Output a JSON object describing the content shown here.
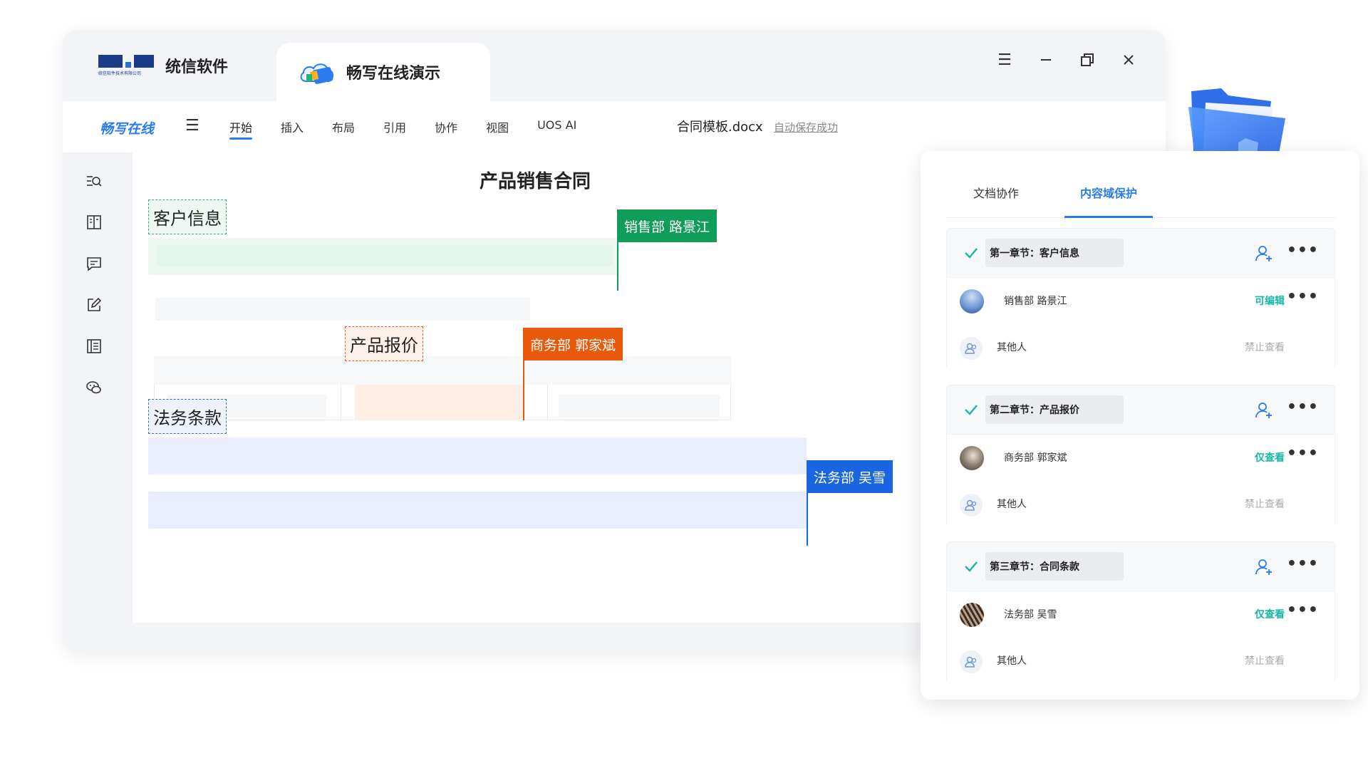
{
  "titlebar": {
    "brand_name": "统信软件",
    "brand_sub": "统信软件技术有限公司",
    "active_tab": "畅写在线演示",
    "controls": [
      "menu-icon",
      "minimize-icon",
      "restore-icon",
      "close-icon"
    ]
  },
  "toolbar": {
    "app_brand": "畅写在线",
    "menu": [
      "开始",
      "插入",
      "布局",
      "引用",
      "协作",
      "视图",
      "UOS AI"
    ],
    "active_menu": "开始",
    "doc_name": "合同模板.docx",
    "autosave": "自动保存成功"
  },
  "rail": {
    "icons": [
      "search-list-icon",
      "book-icon",
      "comment-icon",
      "edit-icon",
      "outline-icon",
      "chat-icon"
    ]
  },
  "document": {
    "title": "产品销售合同",
    "sections": [
      {
        "label": "客户信息",
        "owner": "销售部 路景江",
        "color": "#0f9d58"
      },
      {
        "label": "产品报价",
        "owner": "商务部 郭家斌",
        "color": "#e8590c"
      },
      {
        "label": "法务条款",
        "owner": "法务部 吴雪",
        "color": "#1a66e0"
      }
    ]
  },
  "panel": {
    "tabs": [
      "文档协作",
      "内容域保护"
    ],
    "active_tab": "内容域保护",
    "chapters": [
      {
        "title": "第一章节：客户信息",
        "members": [
          {
            "name": "销售部 路景江",
            "permission": "可编辑"
          },
          {
            "name": "其他人",
            "permission": "禁止查看"
          }
        ]
      },
      {
        "title": "第二章节：产品报价",
        "members": [
          {
            "name": "商务部 郭家斌",
            "permission": "仅查看"
          },
          {
            "name": "其他人",
            "permission": "禁止查看"
          }
        ]
      },
      {
        "title": "第三章节：合同条款",
        "members": [
          {
            "name": "法务部 吴雪",
            "permission": "仅查看"
          },
          {
            "name": "其他人",
            "permission": "禁止查看"
          }
        ]
      }
    ],
    "more_label": "•••"
  },
  "colors": {
    "accent": "#2a7bf0",
    "editable": "#16b8a4",
    "denied": "#aaaaaa"
  }
}
